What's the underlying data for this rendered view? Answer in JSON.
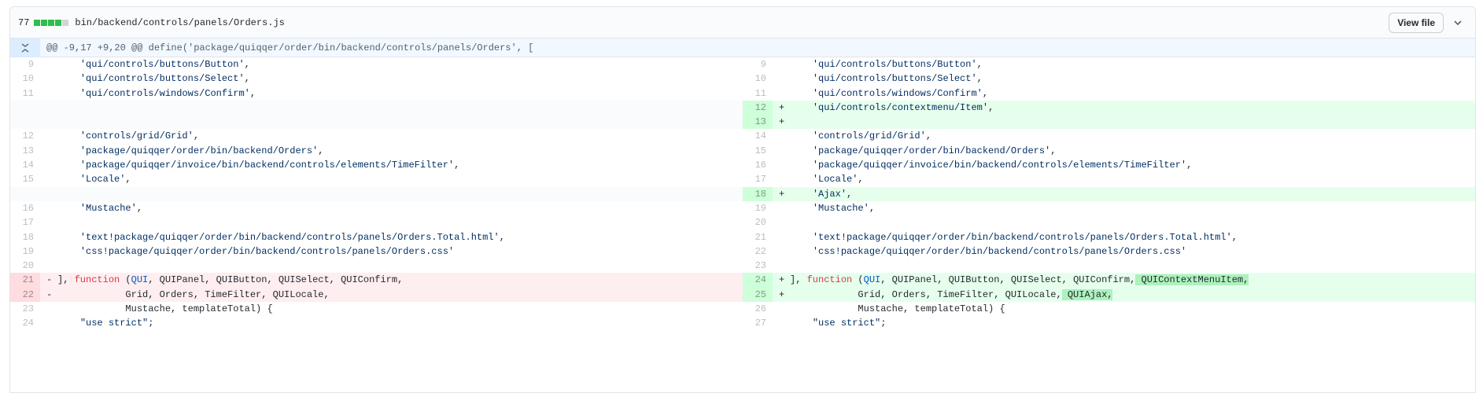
{
  "file": {
    "changes": "77",
    "path": "bin/backend/controls/panels/Orders.js",
    "view_file_label": "View file"
  },
  "hunk": {
    "header": "@@ -9,17 +9,20 @@ define('package/quiqqer/order/bin/backend/controls/panels/Orders', ["
  },
  "rows": [
    {
      "l": {
        "n": "9",
        "type": "ctx",
        "code": "    'qui/controls/buttons/Button',"
      },
      "r": {
        "n": "9",
        "type": "ctx",
        "code": "    'qui/controls/buttons/Button',"
      }
    },
    {
      "l": {
        "n": "10",
        "type": "ctx",
        "code": "    'qui/controls/buttons/Select',"
      },
      "r": {
        "n": "10",
        "type": "ctx",
        "code": "    'qui/controls/buttons/Select',"
      }
    },
    {
      "l": {
        "n": "11",
        "type": "ctx",
        "code": "    'qui/controls/windows/Confirm',"
      },
      "r": {
        "n": "11",
        "type": "ctx",
        "code": "    'qui/controls/windows/Confirm',"
      }
    },
    {
      "l": {
        "n": "",
        "type": "empty",
        "code": ""
      },
      "r": {
        "n": "12",
        "type": "add",
        "code": "    'qui/controls/contextmenu/Item',"
      }
    },
    {
      "l": {
        "n": "",
        "type": "empty",
        "code": ""
      },
      "r": {
        "n": "13",
        "type": "add",
        "code": ""
      }
    },
    {
      "l": {
        "n": "12",
        "type": "ctx",
        "code": "    'controls/grid/Grid',"
      },
      "r": {
        "n": "14",
        "type": "ctx",
        "code": "    'controls/grid/Grid',"
      }
    },
    {
      "l": {
        "n": "13",
        "type": "ctx",
        "code": "    'package/quiqqer/order/bin/backend/Orders',"
      },
      "r": {
        "n": "15",
        "type": "ctx",
        "code": "    'package/quiqqer/order/bin/backend/Orders',"
      }
    },
    {
      "l": {
        "n": "14",
        "type": "ctx",
        "code": "    'package/quiqqer/invoice/bin/backend/controls/elements/TimeFilter',"
      },
      "r": {
        "n": "16",
        "type": "ctx",
        "code": "    'package/quiqqer/invoice/bin/backend/controls/elements/TimeFilter',"
      }
    },
    {
      "l": {
        "n": "15",
        "type": "ctx",
        "code": "    'Locale',"
      },
      "r": {
        "n": "17",
        "type": "ctx",
        "code": "    'Locale',"
      }
    },
    {
      "l": {
        "n": "",
        "type": "empty",
        "code": ""
      },
      "r": {
        "n": "18",
        "type": "add",
        "code": "    'Ajax',"
      }
    },
    {
      "l": {
        "n": "16",
        "type": "ctx",
        "code": "    'Mustache',"
      },
      "r": {
        "n": "19",
        "type": "ctx",
        "code": "    'Mustache',"
      }
    },
    {
      "l": {
        "n": "17",
        "type": "ctx",
        "code": ""
      },
      "r": {
        "n": "20",
        "type": "ctx",
        "code": ""
      }
    },
    {
      "l": {
        "n": "18",
        "type": "ctx",
        "code": "    'text!package/quiqqer/order/bin/backend/controls/panels/Orders.Total.html',"
      },
      "r": {
        "n": "21",
        "type": "ctx",
        "code": "    'text!package/quiqqer/order/bin/backend/controls/panels/Orders.Total.html',"
      }
    },
    {
      "l": {
        "n": "19",
        "type": "ctx",
        "code": "    'css!package/quiqqer/order/bin/backend/controls/panels/Orders.css'"
      },
      "r": {
        "n": "22",
        "type": "ctx",
        "code": "    'css!package/quiqqer/order/bin/backend/controls/panels/Orders.css'"
      }
    },
    {
      "l": {
        "n": "20",
        "type": "ctx",
        "code": ""
      },
      "r": {
        "n": "23",
        "type": "ctx",
        "code": ""
      }
    },
    {
      "l": {
        "n": "21",
        "type": "del",
        "mark": "-",
        "code": "], function (QUI, QUIPanel, QUIButton, QUISelect, QUIConfirm,"
      },
      "r": {
        "n": "24",
        "type": "add",
        "mark": "+",
        "code": "], function (QUI, QUIPanel, QUIButton, QUISelect, QUIConfirm,",
        "hl": " QUIContextMenuItem,"
      }
    },
    {
      "l": {
        "n": "22",
        "type": "del",
        "mark": "-",
        "code": "            Grid, Orders, TimeFilter, QUILocale,"
      },
      "r": {
        "n": "25",
        "type": "add",
        "mark": "+",
        "code": "            Grid, Orders, TimeFilter, QUILocale,",
        "hl": " QUIAjax,"
      }
    },
    {
      "l": {
        "n": "23",
        "type": "ctx",
        "code": "            Mustache, templateTotal) {"
      },
      "r": {
        "n": "26",
        "type": "ctx",
        "code": "            Mustache, templateTotal) {"
      }
    },
    {
      "l": {
        "n": "24",
        "type": "ctx",
        "code": "    \"use strict\";"
      },
      "r": {
        "n": "27",
        "type": "ctx",
        "code": "    \"use strict\";"
      }
    }
  ]
}
